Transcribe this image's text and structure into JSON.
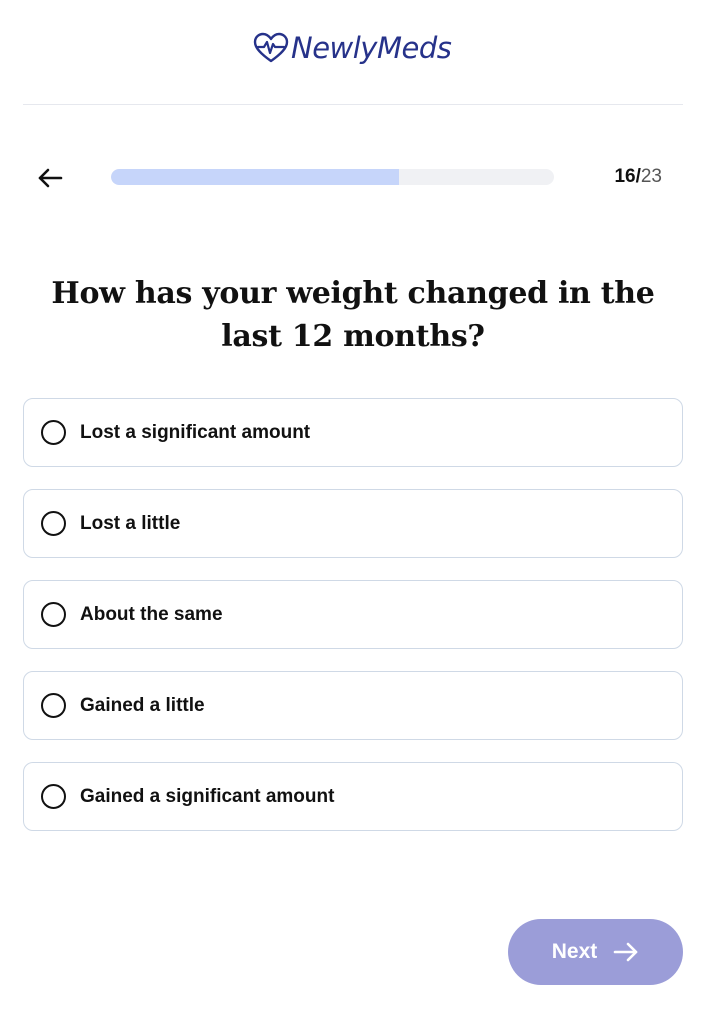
{
  "brand": {
    "name": "NewlyMeds",
    "logo_icon": "heart-pulse-icon",
    "color": "#26328a"
  },
  "nav": {
    "back_icon": "arrow-left-icon"
  },
  "progress": {
    "current": "16",
    "separator": "/",
    "total": "23",
    "fill_fraction": 0.65,
    "fill_color": "#c6d5fa"
  },
  "question": "How has your weight changed in the last 12 months?",
  "options": [
    {
      "label": "Lost a significant amount",
      "selected": false
    },
    {
      "label": "Lost a little",
      "selected": false
    },
    {
      "label": "About the same",
      "selected": false
    },
    {
      "label": "Gained a little",
      "selected": false
    },
    {
      "label": "Gained a significant amount",
      "selected": false
    }
  ],
  "next_button": {
    "label": "Next",
    "icon": "arrow-right-icon",
    "color": "#9b9dd8"
  }
}
